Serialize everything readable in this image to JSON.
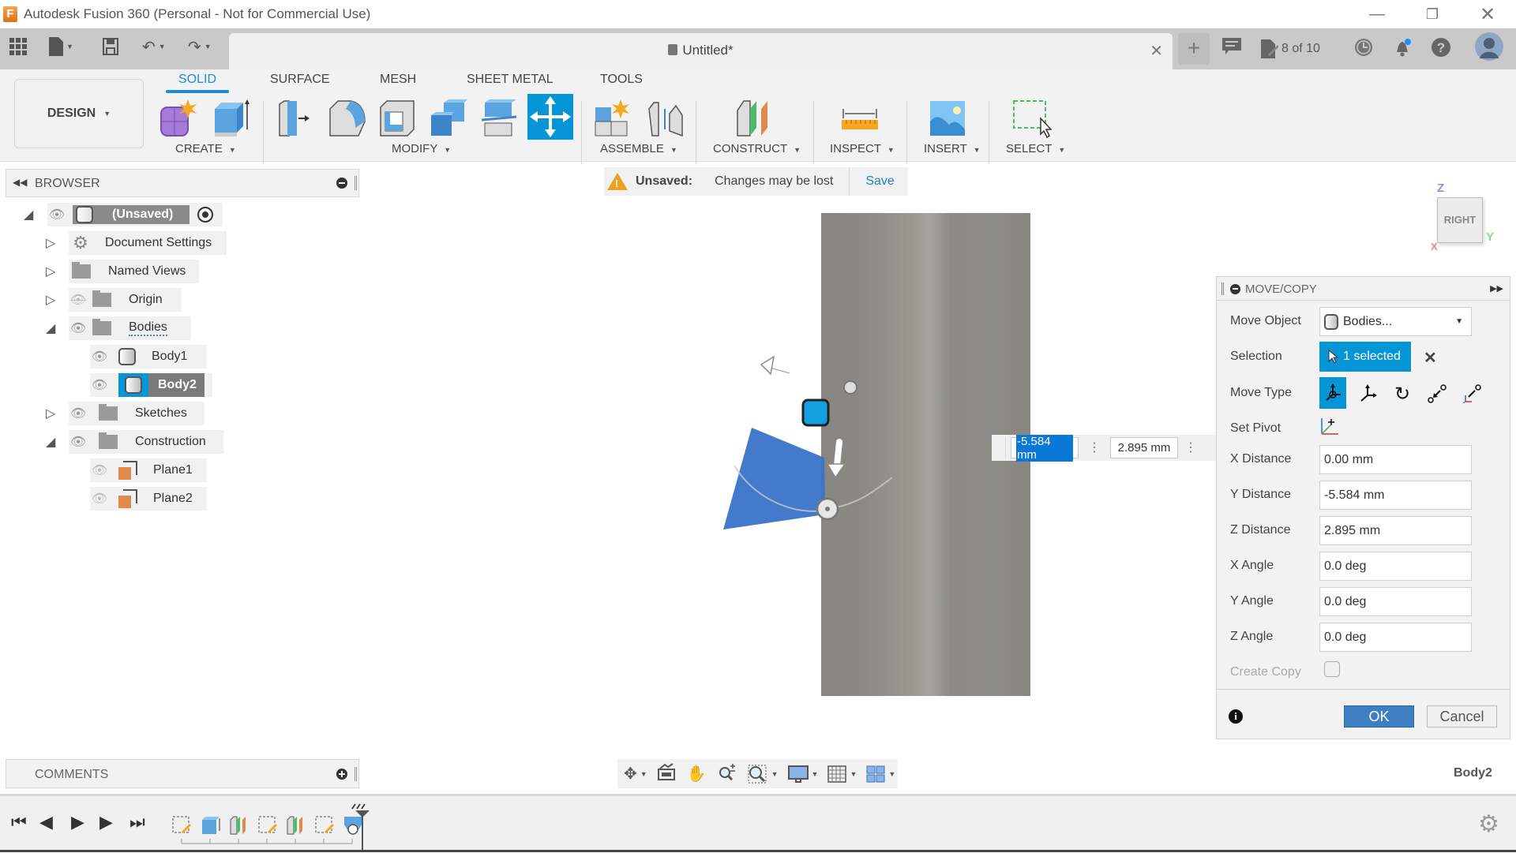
{
  "window": {
    "title": "Autodesk Fusion 360 (Personal - Not for Commercial Use)",
    "logo_letter": "F",
    "controls": [
      "minimize",
      "restore",
      "close"
    ]
  },
  "tabbar": {
    "doc_title": "Untitled*",
    "job_status": "8 of 10",
    "icons": [
      "grid-menu-icon",
      "file-icon",
      "save-icon",
      "undo-icon",
      "redo-icon",
      "new-tab-icon",
      "comment-icon",
      "job-status-icon",
      "clock-icon",
      "bell-icon",
      "help-icon",
      "avatar"
    ]
  },
  "ribbon": {
    "workspace": "DESIGN",
    "tabs": [
      {
        "label": "SOLID",
        "active": true
      },
      {
        "label": "SURFACE",
        "active": false
      },
      {
        "label": "MESH",
        "active": false
      },
      {
        "label": "SHEET METAL",
        "active": false
      },
      {
        "label": "TOOLS",
        "active": false
      }
    ],
    "groups": [
      {
        "label": "CREATE",
        "tools": [
          "new-component-icon",
          "extrude-icon"
        ]
      },
      {
        "label": "MODIFY",
        "tools": [
          "press-pull-icon",
          "fillet-icon",
          "shell-icon",
          "combine-icon",
          "split-face-icon",
          "move-copy-icon"
        ]
      },
      {
        "label": "ASSEMBLE",
        "tools": [
          "new-component-assemble-icon",
          "joint-icon"
        ]
      },
      {
        "label": "CONSTRUCT",
        "tools": [
          "offset-plane-icon"
        ]
      },
      {
        "label": "INSPECT",
        "tools": [
          "measure-icon"
        ]
      },
      {
        "label": "INSERT",
        "tools": [
          "insert-image-icon"
        ]
      },
      {
        "label": "SELECT",
        "tools": [
          "select-window-icon"
        ]
      }
    ],
    "active_tool": "move-copy-icon",
    "accent": "#0696d7"
  },
  "browser": {
    "title": "BROWSER",
    "root": "(Unsaved)",
    "items": [
      {
        "label": "Document Settings",
        "expanded": false,
        "icon": "gear",
        "visible": null
      },
      {
        "label": "Named Views",
        "expanded": false,
        "icon": "folder",
        "visible": null
      },
      {
        "label": "Origin",
        "expanded": false,
        "icon": "folder",
        "visible": false
      },
      {
        "label": "Bodies",
        "expanded": true,
        "icon": "folder",
        "visible": true
      },
      {
        "label": "Body1",
        "icon": "body",
        "visible": true,
        "selected": false
      },
      {
        "label": "Body2",
        "icon": "body",
        "visible": true,
        "selected": true
      },
      {
        "label": "Sketches",
        "expanded": false,
        "icon": "folder",
        "visible": true
      },
      {
        "label": "Construction",
        "expanded": true,
        "icon": "folder",
        "visible": true
      },
      {
        "label": "Plane1",
        "icon": "plane",
        "visible": false
      },
      {
        "label": "Plane2",
        "icon": "plane",
        "visible": false
      }
    ]
  },
  "banner": {
    "status": "Unsaved:",
    "message": "Changes may be lost",
    "action": "Save"
  },
  "viewcube": {
    "face": "RIGHT",
    "axes": {
      "z": "Z",
      "y": "Y",
      "x": "X"
    }
  },
  "inline_inputs": {
    "y_value": "-5.584 mm",
    "z_value": "2.895 mm"
  },
  "dialog": {
    "title": "MOVE/COPY",
    "move_object_label": "Move Object",
    "move_object_value": "Bodies...",
    "selection_label": "Selection",
    "selection_value": "1 selected",
    "move_type_label": "Move Type",
    "move_types": [
      "free-move",
      "translate",
      "rotate",
      "point-to-point",
      "point-to-position"
    ],
    "move_type_active": "free-move",
    "set_pivot_label": "Set Pivot",
    "fields": [
      {
        "label": "X Distance",
        "value": "0.00 mm"
      },
      {
        "label": "Y Distance",
        "value": "-5.584 mm"
      },
      {
        "label": "Z Distance",
        "value": "2.895 mm"
      },
      {
        "label": "X Angle",
        "value": "0.0 deg"
      },
      {
        "label": "Y Angle",
        "value": "0.0 deg"
      },
      {
        "label": "Z Angle",
        "value": "0.0 deg"
      }
    ],
    "create_copy_label": "Create Copy",
    "create_copy_checked": false,
    "ok_label": "OK",
    "cancel_label": "Cancel"
  },
  "comments": {
    "title": "COMMENTS"
  },
  "nav_toolbar": {
    "tools": [
      "orbit-icon",
      "look-at-icon",
      "pan-icon",
      "zoom-icon",
      "fit-icon",
      "display-settings-icon",
      "grid-icon",
      "viewports-icon"
    ]
  },
  "status": {
    "selected_body": "Body2"
  },
  "timeline": {
    "playback": [
      "first",
      "previous",
      "play",
      "next",
      "last"
    ],
    "features": [
      "sketch",
      "extrude",
      "plane",
      "sketch",
      "plane",
      "sketch",
      "move"
    ]
  }
}
